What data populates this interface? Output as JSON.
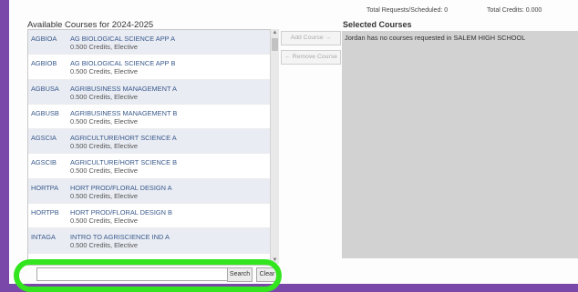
{
  "totals": {
    "requests": "Total Requests/Scheduled:  0",
    "credits": "Total Credits:  0.000"
  },
  "available": {
    "title": "Available Courses for 2024-2025",
    "courses": [
      {
        "code": "AGBIOA",
        "name": "AG BIOLOGICAL SCIENCE APP A",
        "meta": "0.500 Credits,  Elective"
      },
      {
        "code": "AGBIOB",
        "name": "AG BIOLOGICAL SCIENCE APP B",
        "meta": "0.500 Credits,  Elective"
      },
      {
        "code": "AGBUSA",
        "name": "AGRIBUSINESS MANAGEMENT A",
        "meta": "0.500 Credits,  Elective"
      },
      {
        "code": "AGBUSB",
        "name": "AGRIBUSINESS MANAGEMENT B",
        "meta": "0.500 Credits,  Elective"
      },
      {
        "code": "AGSCIA",
        "name": "AGRICULTURE/HORT SCIENCE A",
        "meta": "0.500 Credits,  Elective"
      },
      {
        "code": "AGSCIB",
        "name": "AGRICULTURE/HORT SCIENCE B",
        "meta": "0.500 Credits,  Elective"
      },
      {
        "code": "HORTPA",
        "name": "HORT PROD/FLORAL DESIGN A",
        "meta": "0.500 Credits,  Elective"
      },
      {
        "code": "HORTPB",
        "name": "HORT PROD/FLORAL DESIGN B",
        "meta": "0.500 Credits,  Elective"
      },
      {
        "code": "INTAGA",
        "name": "INTRO TO AGRISCIENCE IND A",
        "meta": "0.500 Credits,  Elective"
      }
    ]
  },
  "buttons": {
    "add": "Add Course →",
    "remove": "← Remove Course",
    "search": "Search",
    "clear": "Clear"
  },
  "selected": {
    "title": "Selected Courses",
    "empty_message": "Jordan has no courses requested in SALEM HIGH SCHOOL"
  },
  "search": {
    "value": ""
  },
  "colors": {
    "sidebar": "#7a48a8",
    "highlight": "#33e51f",
    "link": "#3a5a8c"
  }
}
